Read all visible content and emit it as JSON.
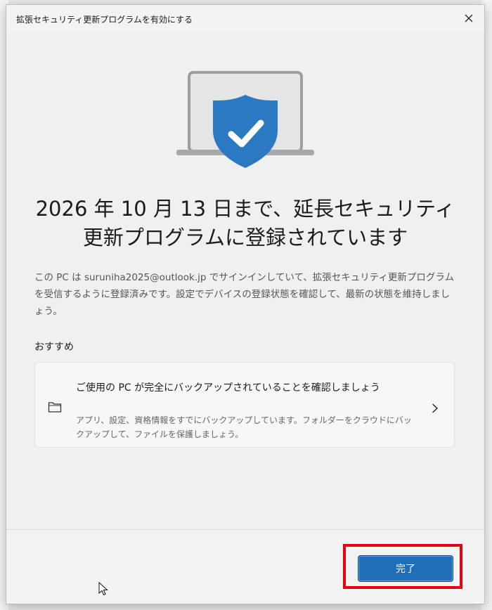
{
  "dialog": {
    "title": "拡張セキュリティ更新プログラムを有効にする",
    "headline": "2026 年 10 月 13 日まで、延長セキュリティ更新プログラムに登録されています",
    "body": "この PC は suruniha2025@outlook.jp でサインインしていて、拡張セキュリティ更新プログラムを受信するように登録済みです。設定でデバイスの登録状態を確認して、最新の状態を維持しましょう。",
    "recommended_label": "おすすめ",
    "recommendation": {
      "title": "ご使用の PC が完全にバックアップされていることを確認しましょう",
      "description": "アプリ、設定、資格情報をすでにバックアップしています。フォルダーをクラウドにバックアップして、ファイルを保護しましょう。",
      "icon": "folder-icon"
    },
    "done_label": "完了"
  },
  "colors": {
    "accent": "#1f6fb8",
    "shield": "#2b79c2",
    "highlight": "#e60012"
  }
}
